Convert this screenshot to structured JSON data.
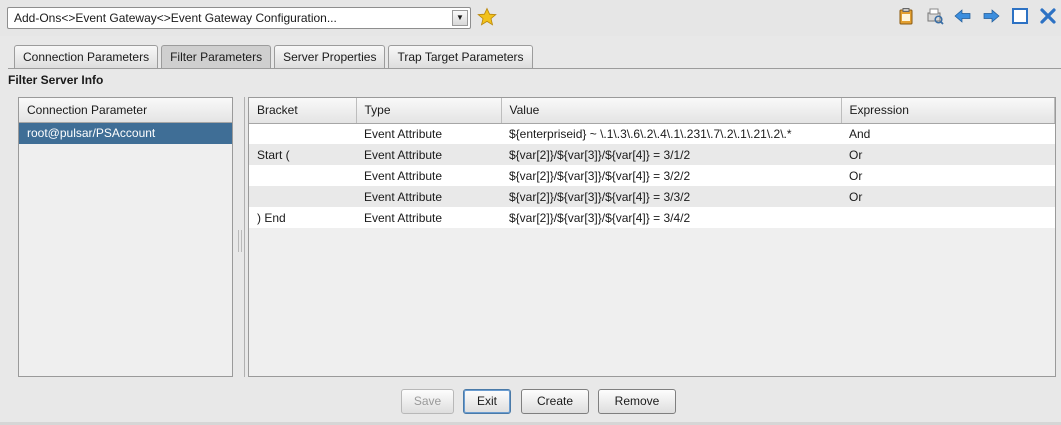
{
  "header": {
    "path_select_value": "Add-Ons<>Event Gateway<>Event Gateway Configuration...",
    "toolbar_icons": [
      "clipboard-icon",
      "print-preview-icon",
      "back-arrow-icon",
      "forward-arrow-icon",
      "maximize-icon",
      "close-icon"
    ]
  },
  "tabs": [
    {
      "label": "Connection Parameters",
      "active": false
    },
    {
      "label": "Filter Parameters",
      "active": true
    },
    {
      "label": "Server Properties",
      "active": false
    },
    {
      "label": "Trap Target Parameters",
      "active": false
    }
  ],
  "section_title": "Filter Server Info",
  "connection_list": {
    "header": "Connection Parameter",
    "items": [
      "root@pulsar/PSAccount"
    ]
  },
  "filter_table": {
    "columns": [
      "Bracket",
      "Type",
      "Value",
      "Expression"
    ],
    "rows": [
      {
        "bracket": "",
        "type": "Event Attribute",
        "value": "${enterpriseid} ~ \\.1\\.3\\.6\\.2\\.4\\.1\\.231\\.7\\.2\\.1\\.21\\.2\\.*",
        "expression": "And"
      },
      {
        "bracket": "Start (",
        "type": "Event Attribute",
        "value": "${var[2]}/${var[3]}/${var[4]} = 3/1/2",
        "expression": "Or"
      },
      {
        "bracket": "",
        "type": "Event Attribute",
        "value": "${var[2]}/${var[3]}/${var[4]} = 3/2/2",
        "expression": "Or"
      },
      {
        "bracket": "",
        "type": "Event Attribute",
        "value": "${var[2]}/${var[3]}/${var[4]} = 3/3/2",
        "expression": "Or"
      },
      {
        "bracket": ") End",
        "type": "Event Attribute",
        "value": "${var[2]}/${var[3]}/${var[4]} = 3/4/2",
        "expression": ""
      }
    ]
  },
  "buttons": {
    "save": "Save",
    "exit": "Exit",
    "create": "Create",
    "remove": "Remove"
  },
  "colors": {
    "selection": "#3f6e96",
    "star": "#f2c21c"
  }
}
